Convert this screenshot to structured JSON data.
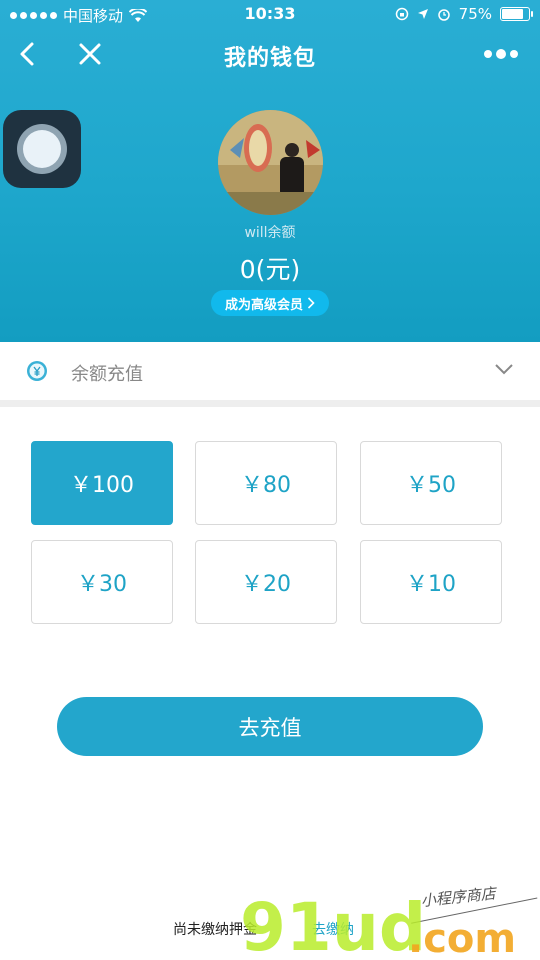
{
  "status_bar": {
    "carrier": "中国移动",
    "time": "10:33",
    "battery": "75%",
    "battery_level": 0.75
  },
  "nav": {
    "title": "我的钱包",
    "back_icon": "chevron-left-icon",
    "close_icon": "close-icon",
    "more_icon": "more-dots-icon"
  },
  "profile": {
    "nickname": "will余额",
    "balance": "0(元)",
    "vip_button": "成为高级会员"
  },
  "recharge": {
    "label": "余额充值",
    "icon": "yen-refresh-icon"
  },
  "amounts": [
    {
      "label": "￥100",
      "selected": true
    },
    {
      "label": "￥80",
      "selected": false
    },
    {
      "label": "￥50",
      "selected": false
    },
    {
      "label": "￥30",
      "selected": false
    },
    {
      "label": "￥20",
      "selected": false
    },
    {
      "label": "￥10",
      "selected": false
    }
  ],
  "submit_label": "去充值",
  "footer": {
    "deposit_text": "尚未缴纳押金",
    "deposit_link": "去缴纳"
  },
  "watermark": {
    "main": "91ud",
    "sub": ".com",
    "tagline": "小程序商店"
  },
  "colors": {
    "accent": "#23a6cc",
    "header_top": "#2aaed4",
    "vip": "#11b9ec"
  }
}
